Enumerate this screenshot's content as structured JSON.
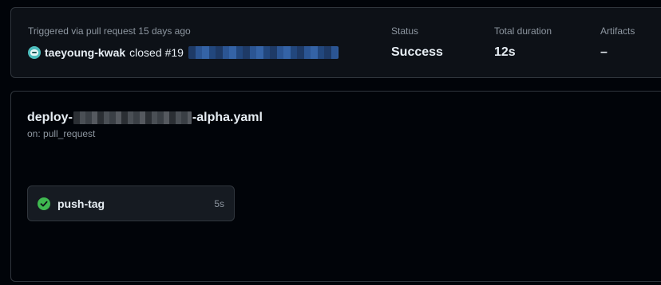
{
  "summary": {
    "trigger_text": "Triggered via pull request 15 days ago",
    "actor": "taeyoung-kwak",
    "action": "closed",
    "pr_number": "#19",
    "status_label": "Status",
    "status_value": "Success",
    "duration_label": "Total duration",
    "duration_value": "12s",
    "artifacts_label": "Artifacts",
    "artifacts_value": "–"
  },
  "workflow": {
    "title_prefix": "deploy-",
    "title_suffix": "-alpha.yaml",
    "on_text": "on: pull_request"
  },
  "jobs": [
    {
      "name": "push-tag",
      "duration": "5s",
      "status": "success",
      "icon": "check-circle-icon"
    }
  ],
  "colors": {
    "background": "#010409",
    "card": "#0d1117",
    "border": "#30363d",
    "success": "#3fb950",
    "muted_text": "#8d96a0"
  }
}
